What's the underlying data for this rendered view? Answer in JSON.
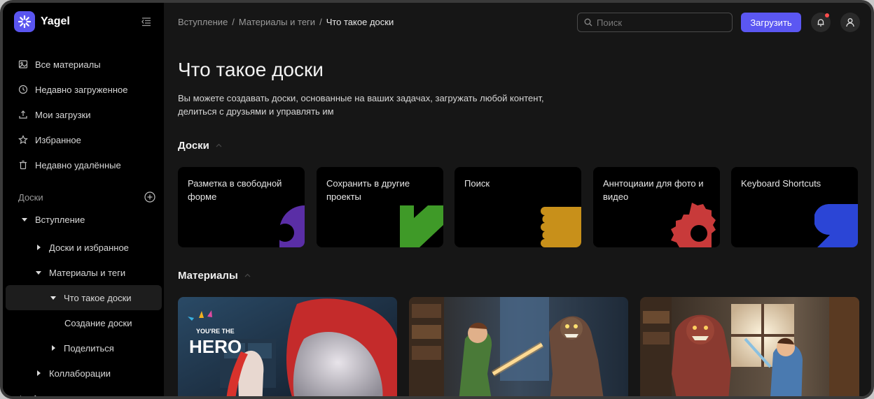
{
  "app": {
    "name": "Yagel"
  },
  "sidebar": {
    "items": [
      {
        "label": "Все материалы",
        "icon": "image-icon"
      },
      {
        "label": "Недавно загруженное",
        "icon": "clock-icon"
      },
      {
        "label": "Мои загрузки",
        "icon": "upload-icon"
      },
      {
        "label": "Избранное",
        "icon": "star-icon"
      },
      {
        "label": "Недавно удалённые",
        "icon": "trash-icon"
      }
    ],
    "boards_section": "Доски",
    "tree": [
      {
        "label": "Вступление",
        "level": 0,
        "expanded": true
      },
      {
        "label": "Доски и избранное",
        "level": 1,
        "expanded": false
      },
      {
        "label": "Материалы и теги",
        "level": 1,
        "expanded": true
      },
      {
        "label": "Что такое доски",
        "level": 2,
        "expanded": true,
        "active": true
      },
      {
        "label": "Создание доски",
        "level": 3,
        "expanded": null
      },
      {
        "label": "Поделиться",
        "level": 2,
        "expanded": false
      },
      {
        "label": "Коллаборации",
        "level": 1,
        "expanded": false
      },
      {
        "label": "Ассистент",
        "level": 0,
        "expanded": false
      }
    ]
  },
  "header": {
    "breadcrumb": [
      "Вступление",
      "Материалы и теги",
      "Что такое доски"
    ],
    "search_placeholder": "Поиск",
    "upload_label": "Загрузить"
  },
  "main": {
    "title": "Что такое доски",
    "description": "Вы можете создавать доски, основанные на ваших задачах, загружать любой контент, делиться с друзьями и управлять им",
    "boards_title": "Доски",
    "boards": [
      {
        "label": "Разметка в свободной форме",
        "color": "#5a2ea6"
      },
      {
        "label": "Сохранить в другие проекты",
        "color": "#3f9a28"
      },
      {
        "label": "Поиск",
        "color": "#c8901a"
      },
      {
        "label": "Аннтоциаии для фото и видео",
        "color": "#c83a3a"
      },
      {
        "label": "Keyboard Shortcuts",
        "color": "#2b45d6"
      }
    ],
    "materials_title": "Материалы",
    "materials": [
      {
        "badge_small": "YOU'RE THE",
        "badge_big": "HERO"
      },
      {
        "badge_small": "",
        "badge_big": ""
      },
      {
        "badge_small": "",
        "badge_big": ""
      }
    ]
  },
  "colors": {
    "accent": "#5b57f2",
    "background": "#161616",
    "sidebar": "#000000"
  }
}
